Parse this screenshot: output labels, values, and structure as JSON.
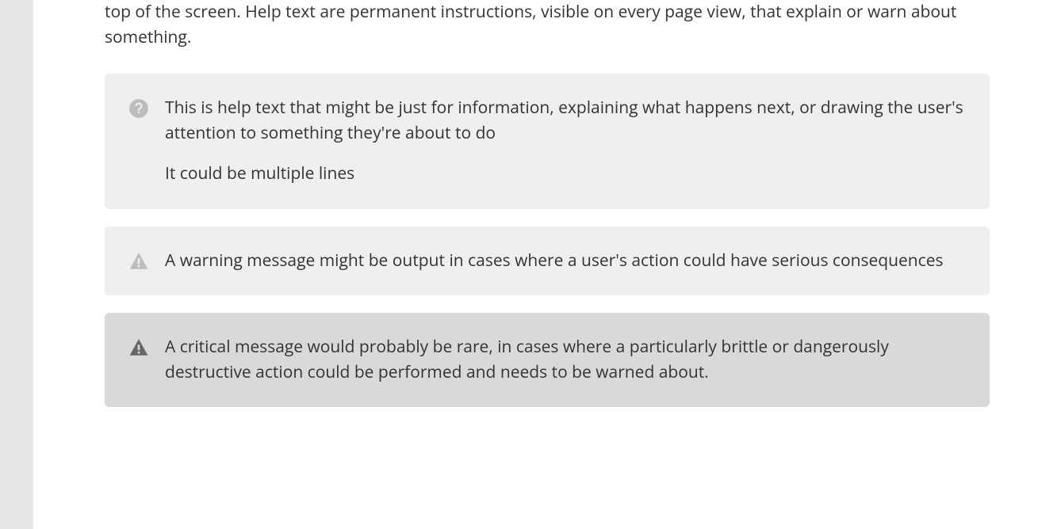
{
  "intro": {
    "text": "top of the screen. Help text are permanent instructions, visible on every page view, that explain or warn about something."
  },
  "blocks": {
    "info": {
      "p1": "This is help text that might be just for information, explaining what happens next, or drawing the user's attention to something they're about to do",
      "p2": "It could be multiple lines"
    },
    "warning": {
      "p1": "A warning message might be output in cases where a user's action could have serious consequences"
    },
    "critical": {
      "p1": "A critical message would probably be rare, in cases where a particularly brittle or dangerously destructive action could be performed and needs to be warned about."
    }
  },
  "colors": {
    "icon_muted": "#bdbdbd",
    "icon_dark": "#666666",
    "bg_light": "#efefef",
    "bg_dark": "#d9d9d9"
  }
}
